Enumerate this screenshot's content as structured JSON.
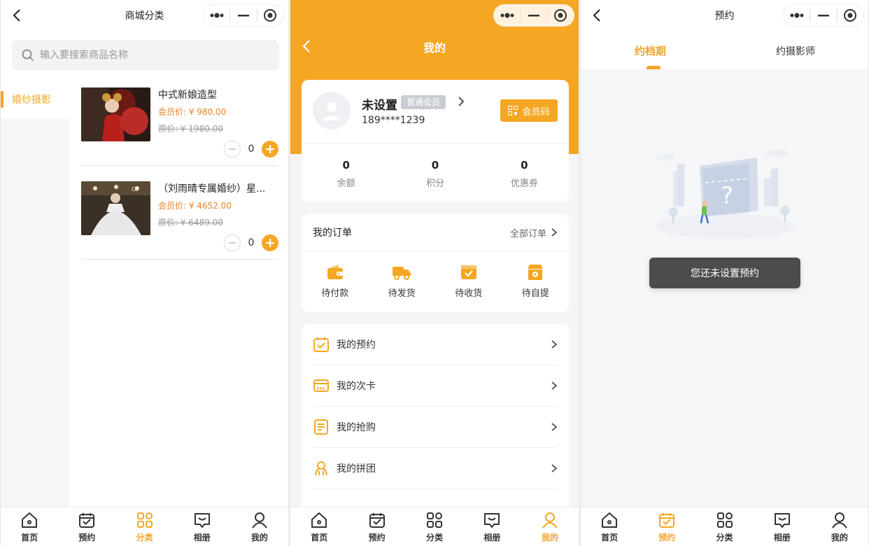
{
  "colors": {
    "accent": "#f5a623",
    "accent_text": "#f2a42c",
    "price": "#e6842a"
  },
  "capsule": {
    "icons": [
      "more-icon",
      "minimize-icon",
      "close-circle-icon"
    ]
  },
  "tabbar": {
    "items": [
      {
        "label": "首页",
        "icon": "home-icon"
      },
      {
        "label": "预约",
        "icon": "calendar-check-icon"
      },
      {
        "label": "分类",
        "icon": "grid-icon"
      },
      {
        "label": "相册",
        "icon": "album-icon"
      },
      {
        "label": "我的",
        "icon": "user-icon"
      }
    ]
  },
  "panel1": {
    "title": "商城分类",
    "search_placeholder": "输入要搜索商品名称",
    "category": "婚纱摄影",
    "products": [
      {
        "name": "中式新娘造型",
        "member_price": "会员价: ¥ 980.00",
        "original_price": "原价: ¥ 1980.00",
        "qty": "0"
      },
      {
        "name": "（刘雨晴专属婚纱）星...",
        "member_price": "会员价: ¥ 4652.00",
        "original_price": "原价: ¥ 6489.00",
        "qty": "0"
      }
    ],
    "active_tab": 2
  },
  "panel2": {
    "title": "我的",
    "user": {
      "name": "未设置",
      "badge": "普通会员",
      "phone": "189****1239",
      "member_code": "会员码"
    },
    "stats": [
      {
        "num": "0",
        "label": "余额"
      },
      {
        "num": "0",
        "label": "积分"
      },
      {
        "num": "0",
        "label": "优惠券"
      }
    ],
    "orders": {
      "heading": "我的订单",
      "all_label": "全部订单",
      "items": [
        {
          "label": "待付款",
          "icon": "wallet-icon"
        },
        {
          "label": "待发货",
          "icon": "truck-icon"
        },
        {
          "label": "待收货",
          "icon": "box-check-icon"
        },
        {
          "label": "待自提",
          "icon": "store-icon"
        }
      ]
    },
    "menu": [
      {
        "label": "我的预约",
        "icon": "calendar-icon"
      },
      {
        "label": "我的次卡",
        "icon": "card-icon"
      },
      {
        "label": "我的抢购",
        "icon": "list-icon"
      },
      {
        "label": "我的拼团",
        "icon": "group-icon"
      }
    ],
    "active_tab": 4
  },
  "panel3": {
    "title": "预约",
    "segments": [
      "约档期",
      "约摄影师"
    ],
    "active_segment": 0,
    "toast": "您还未设置预约",
    "active_tab": 1
  }
}
